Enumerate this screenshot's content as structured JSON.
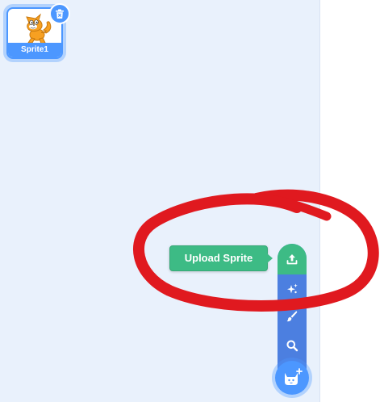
{
  "sprite_pane": {
    "sprites": [
      {
        "name": "Sprite1",
        "selected": true,
        "thumbnail_icon": "scratch-cat-icon"
      }
    ],
    "delete_icon": "trash-icon"
  },
  "sprite_menu": {
    "tooltip": "Upload Sprite",
    "items": [
      {
        "id": "upload",
        "icon": "upload-icon",
        "color": "#3dbb85",
        "active": true
      },
      {
        "id": "surprise",
        "icon": "sparkle-icon",
        "color": "#4c7fe0"
      },
      {
        "id": "paint",
        "icon": "paintbrush-icon",
        "color": "#4c7fe0"
      },
      {
        "id": "search",
        "icon": "search-icon",
        "color": "#4c7fe0"
      }
    ],
    "main_button_icon": "cat-plus-icon"
  },
  "annotation": {
    "shape": "hand-drawn-ellipse",
    "color": "#e0191f"
  },
  "colors": {
    "pane_background": "#e9f1fc",
    "accent_blue": "#4c97ff",
    "menu_blue": "#4c7fe0",
    "upload_green": "#3dbb85"
  }
}
